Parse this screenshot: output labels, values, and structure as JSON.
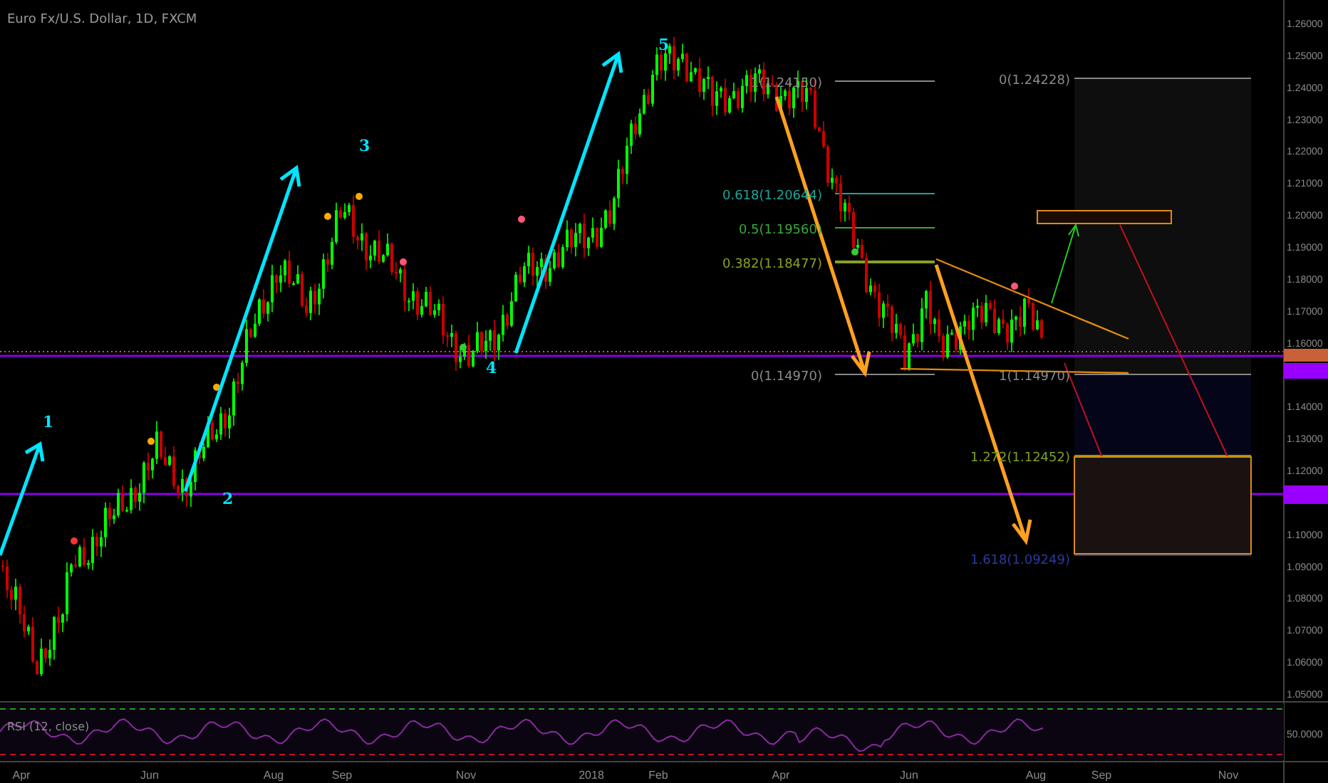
{
  "title": "Euro Fx/U.S. Dollar, 1D, FXCM",
  "price_ticks": [
    "1.26000",
    "1.25000",
    "1.24000",
    "1.23000",
    "1.22000",
    "1.21000",
    "1.20000",
    "1.19000",
    "1.18000",
    "1.17000",
    "1.16000",
    "1.14000",
    "1.13000",
    "1.12000",
    "1.10000",
    "1.09000",
    "1.08000",
    "1.07000",
    "1.06000",
    "1.05000"
  ],
  "date_labels": [
    "Apr",
    "Jun",
    "Aug",
    "Sep",
    "Nov",
    "2018",
    "Feb",
    "Apr",
    "Jun",
    "Aug",
    "Sep",
    "Nov"
  ],
  "wave_labels": [
    {
      "text": "1",
      "color": "#00e5ff"
    },
    {
      "text": "2",
      "color": "#00e5ff"
    },
    {
      "text": "3",
      "color": "#00e5ff"
    },
    {
      "text": "4",
      "color": "#00e5ff"
    },
    {
      "text": "5",
      "color": "#00e5ff"
    }
  ],
  "fib_labels": [
    {
      "text": "1(1.24150)",
      "color": "#8a8a8a"
    },
    {
      "text": "0.618(1.20644)",
      "color": "#1aa69a"
    },
    {
      "text": "0.5(1.19560)",
      "color": "#3aa83a"
    },
    {
      "text": "0.382(1.18477)",
      "color": "#8aa020"
    },
    {
      "text": "0(1.14970)",
      "color": "#8a8a8a"
    },
    {
      "text": "0(1.24228)",
      "color": "#8a8a8a"
    },
    {
      "text": "1(1.14970)",
      "color": "#8a8a8a"
    },
    {
      "text": "1.272(1.12452)",
      "color": "#7ca020"
    },
    {
      "text": "1.618(1.09249)",
      "color": "#2a3aa0"
    }
  ],
  "indicator": {
    "label": "RSI (12, close)",
    "tick": "50.0000"
  }
}
